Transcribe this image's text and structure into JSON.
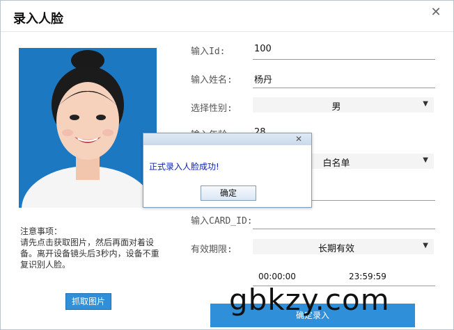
{
  "window": {
    "title": "录入人脸",
    "close_glyph": "✕"
  },
  "photo": {
    "alt": ""
  },
  "notes": {
    "heading": "注意事项：",
    "body": "请先点击获取图片，然后再面对着设备。离开设备镜头后3秒内，设备不重复识别人脸。"
  },
  "capture_button": {
    "label": "抓取图片"
  },
  "form": {
    "id_label": "输入Id:",
    "id_value": "100",
    "name_label": "输入姓名:",
    "name_value": "杨丹",
    "gender_label": "选择性别:",
    "gender_value": "男",
    "age_label": "输入年龄:",
    "age_value": "28",
    "list_value": "白名单",
    "card_label": "输入CARD_ID:",
    "validity_label": "有效期限:",
    "validity_value": "长期有效",
    "time_start": "00:00:00",
    "time_end": "23:59:59",
    "dropdown_arrow": "▼"
  },
  "submit_button": {
    "label": "确定录入"
  },
  "watermark": "gbkzy.com",
  "dialog": {
    "close_glyph": "✕",
    "message": "正式录入人脸成功!",
    "ok_label": "确定"
  },
  "colors": {
    "accent": "#2f8fd8",
    "photo_bg": "#1e7cc8",
    "dialog_text": "#0b22b8"
  }
}
